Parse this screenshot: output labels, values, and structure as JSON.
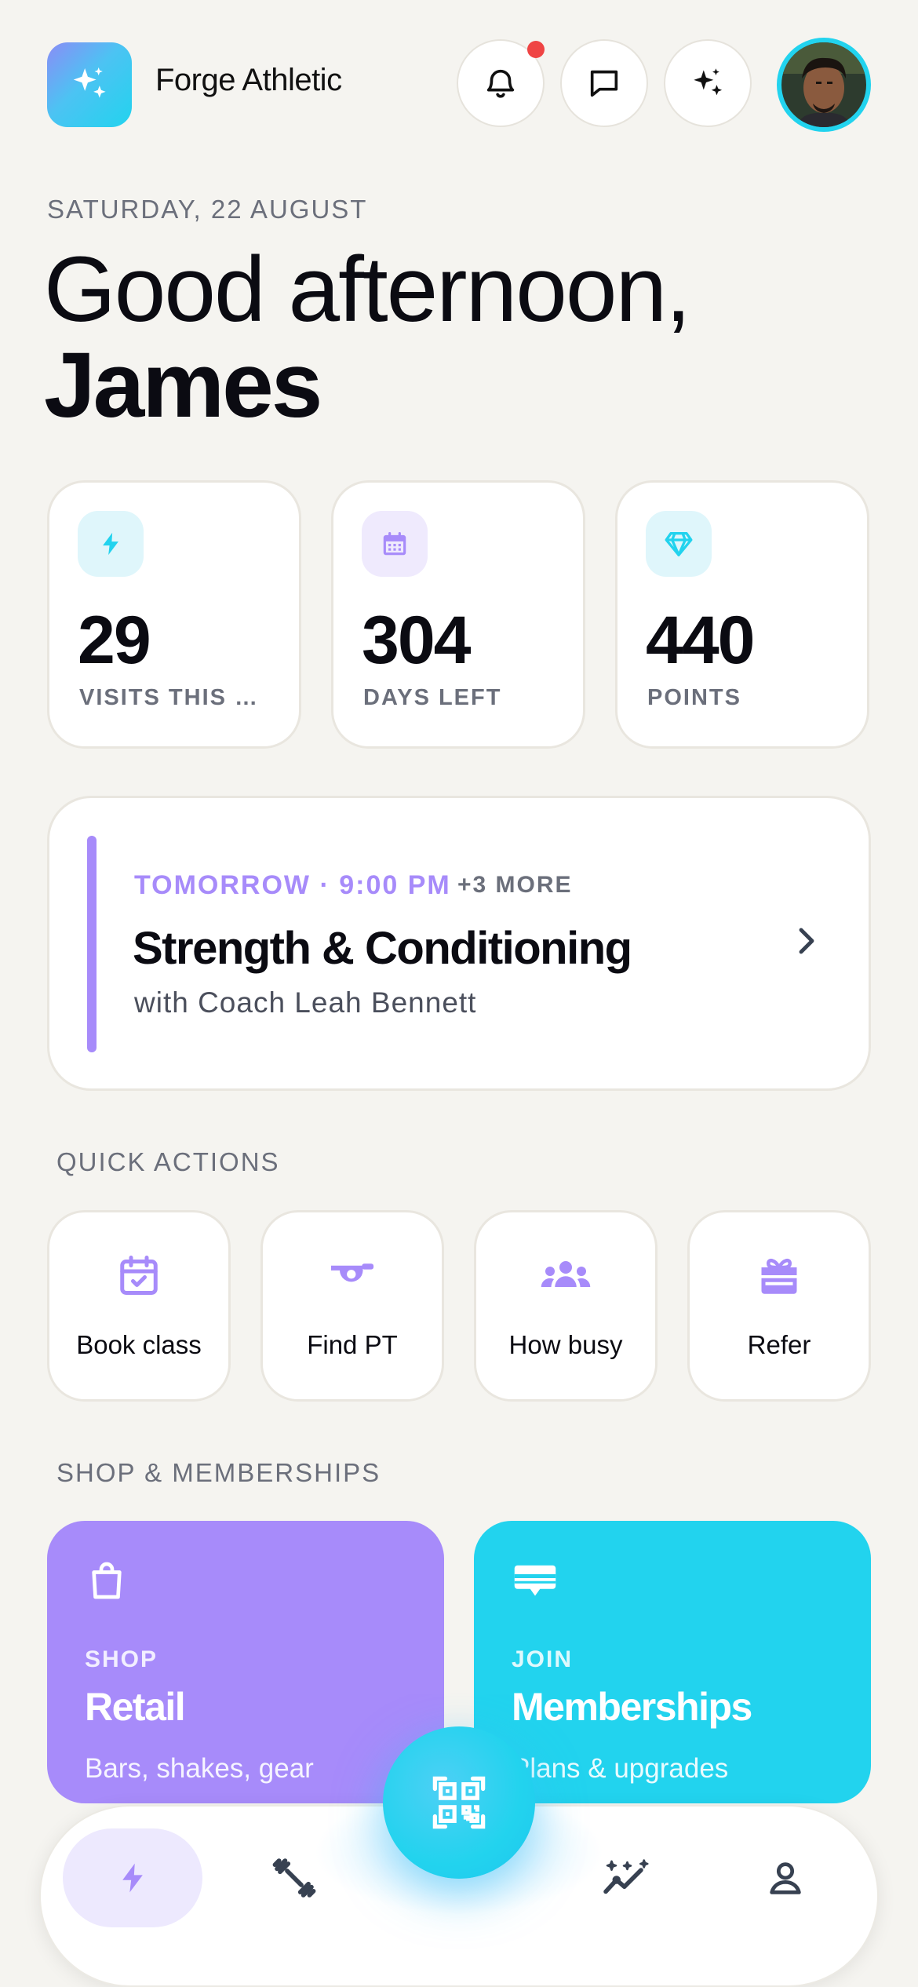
{
  "header": {
    "brand": "Forge Athletic",
    "logo_icon": "sparkles-icon",
    "actions": [
      {
        "name": "notifications",
        "icon": "bell-icon",
        "has_badge": true
      },
      {
        "name": "messages",
        "icon": "chat-icon"
      },
      {
        "name": "assistant",
        "icon": "sparkles-icon"
      }
    ],
    "avatar_ring_color": "#22d3ee"
  },
  "greeting": {
    "date": "SATURDAY, 22 AUGUST",
    "line1": "Good afternoon,",
    "name": "James"
  },
  "stats": [
    {
      "value": "29",
      "label": "VISITS THIS MONTH",
      "icon": "bolt-icon",
      "color": "#22d3ee",
      "bg": "#dff6fb"
    },
    {
      "value": "304",
      "label": "DAYS LEFT",
      "icon": "calendar-icon",
      "color": "#a78bfa",
      "bg": "#efeafd"
    },
    {
      "value": "440",
      "label": "POINTS",
      "icon": "diamond-icon",
      "color": "#22d3ee",
      "bg": "#dff6fb"
    }
  ],
  "next_session": {
    "when": "TOMORROW · 9:00 PM",
    "more": "+3 MORE",
    "title": "Strength & Conditioning",
    "coach": "with Coach Leah Bennett"
  },
  "quick_actions": {
    "heading": "QUICK ACTIONS",
    "items": [
      {
        "label": "Book class",
        "icon": "calendar-check-icon"
      },
      {
        "label": "Find PT",
        "icon": "whistle-icon"
      },
      {
        "label": "How busy",
        "icon": "people-icon"
      },
      {
        "label": "Refer",
        "icon": "gift-icon"
      }
    ]
  },
  "shop": {
    "heading": "SHOP & MEMBERSHIPS",
    "tiles": [
      {
        "kicker": "SHOP",
        "title": "Retail",
        "subtitle": "Bars, shakes, gear",
        "icon": "bag-icon",
        "color": "#a78bfa"
      },
      {
        "kicker": "JOIN",
        "title": "Memberships",
        "subtitle": "Plans & upgrades",
        "icon": "card-icon",
        "color": "#22d3ee"
      }
    ]
  },
  "bottom_nav": {
    "items": [
      {
        "name": "home",
        "icon": "bolt-icon",
        "active": true
      },
      {
        "name": "workouts",
        "icon": "dumbbell-icon"
      },
      {
        "name": "check-in",
        "icon": "qr-code-icon"
      },
      {
        "name": "progress",
        "icon": "trend-sparkle-icon"
      },
      {
        "name": "profile",
        "icon": "user-icon"
      }
    ],
    "accent": "#a78bfa"
  }
}
